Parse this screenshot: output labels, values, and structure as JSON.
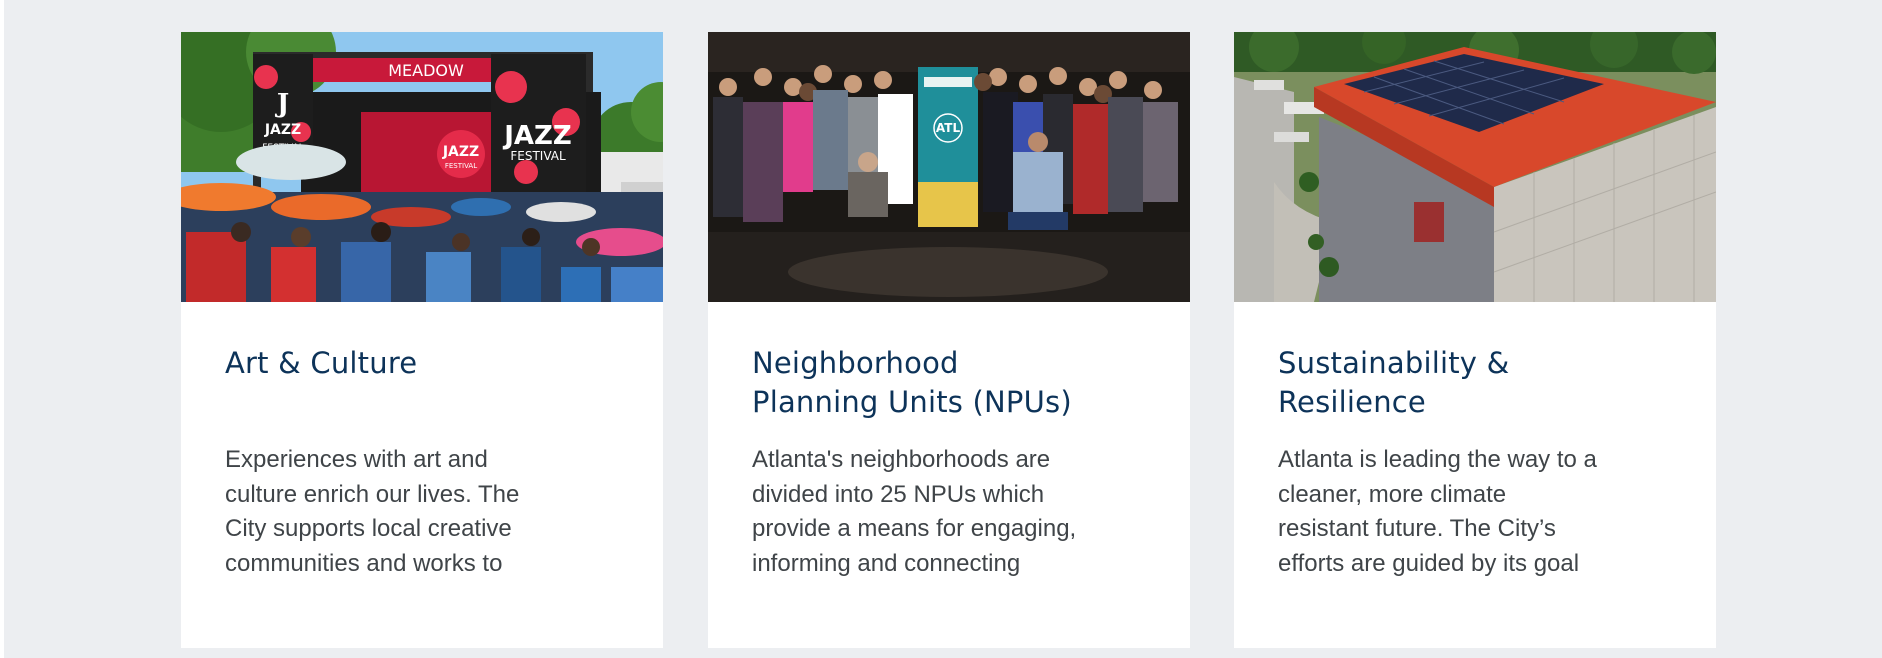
{
  "cards": [
    {
      "image_alt": "Crowd at an outdoor jazz festival in front of a stage with red Jazz Festival banners",
      "image_text": {
        "banner_top": "MEADOW",
        "banner_left_1": "J",
        "banner_left_2": "JAZZ",
        "banner_left_3": "FESTIVAL",
        "banner_right_1": "JAZZ",
        "banner_right_2": "FESTIVAL",
        "stage_logo_1": "JAZZ",
        "stage_logo_2": "FESTIVAL"
      },
      "title_lines": [
        "Art & Culture"
      ],
      "desc_lines": [
        "Experiences with art and",
        "culture enrich our lives. The",
        "City supports local creative",
        "communities and works to"
      ]
    },
    {
      "image_alt": "Group photo of people standing around an ATL banner in a dark hall",
      "image_text": {
        "banner": "ATL"
      },
      "title_lines": [
        "Neighborhood",
        "Planning Units (NPUs)"
      ],
      "desc_lines": [
        "Atlanta's neighborhoods are",
        "divided into 25 NPUs which",
        "provide a means for engaging,",
        "informing and connecting"
      ]
    },
    {
      "image_alt": "Aerial view of a building with a red roof covered in solar panels",
      "image_text": {},
      "title_lines": [
        "Sustainability &",
        "Resilience"
      ],
      "desc_lines": [
        "Atlanta is leading the way to a",
        "cleaner, more climate",
        "resistant future. The City’s",
        "efforts are guided by its goal"
      ]
    }
  ],
  "colors": {
    "page_background": "#eceef1",
    "card_background": "#ffffff",
    "title": "#0d3359",
    "body_text": "#3f4448"
  }
}
